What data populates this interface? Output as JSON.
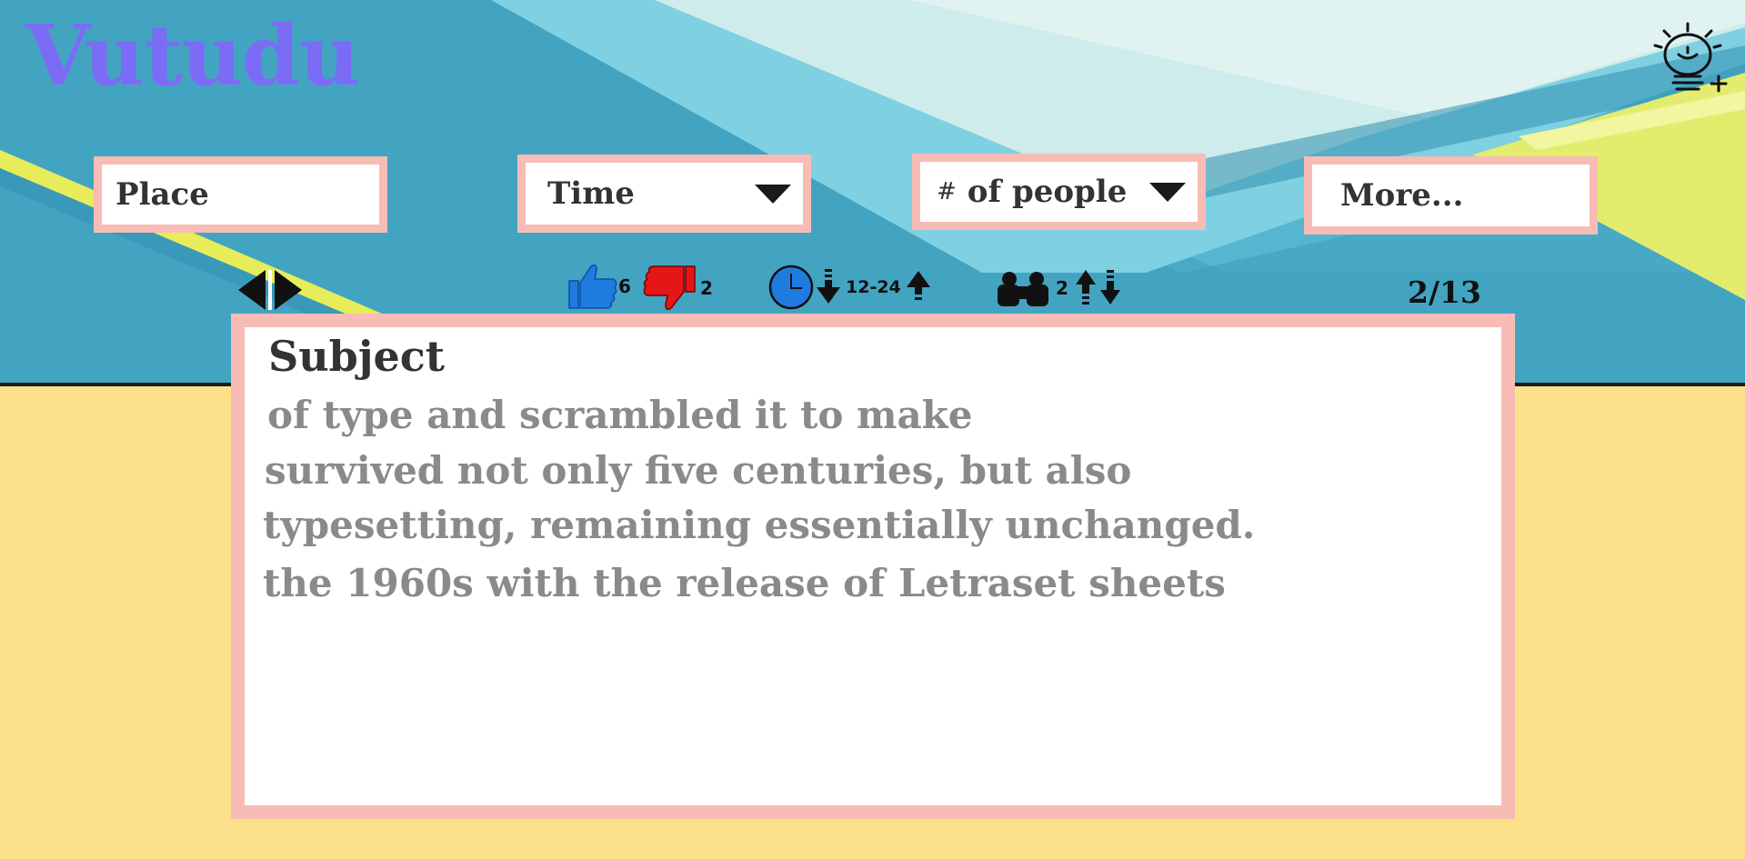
{
  "app": {
    "title": "Vutudu"
  },
  "header": {
    "idea_icon": "lightbulb-plus-icon"
  },
  "filters": {
    "place_placeholder": "Place",
    "time_label": "Time",
    "people_hash": "#",
    "people_label": "of people",
    "more_label": "More..."
  },
  "stats": {
    "likes": "6",
    "dislikes": "2",
    "time_range": "12-24",
    "people_count": "2"
  },
  "pager": {
    "position": "2/13"
  },
  "card": {
    "subject": "Subject",
    "lines": [
      "of type and scrambled it to make",
      "survived not only five centuries, but also",
      "typesetting, remaining essentially unchanged.",
      "the 1960s with the release of Letraset sheets"
    ]
  },
  "colors": {
    "logo": "#7b6cf6",
    "field_border": "#f8bcb6",
    "like": "#1f7be0",
    "dislike": "#e51616",
    "background": "#fde08a"
  }
}
